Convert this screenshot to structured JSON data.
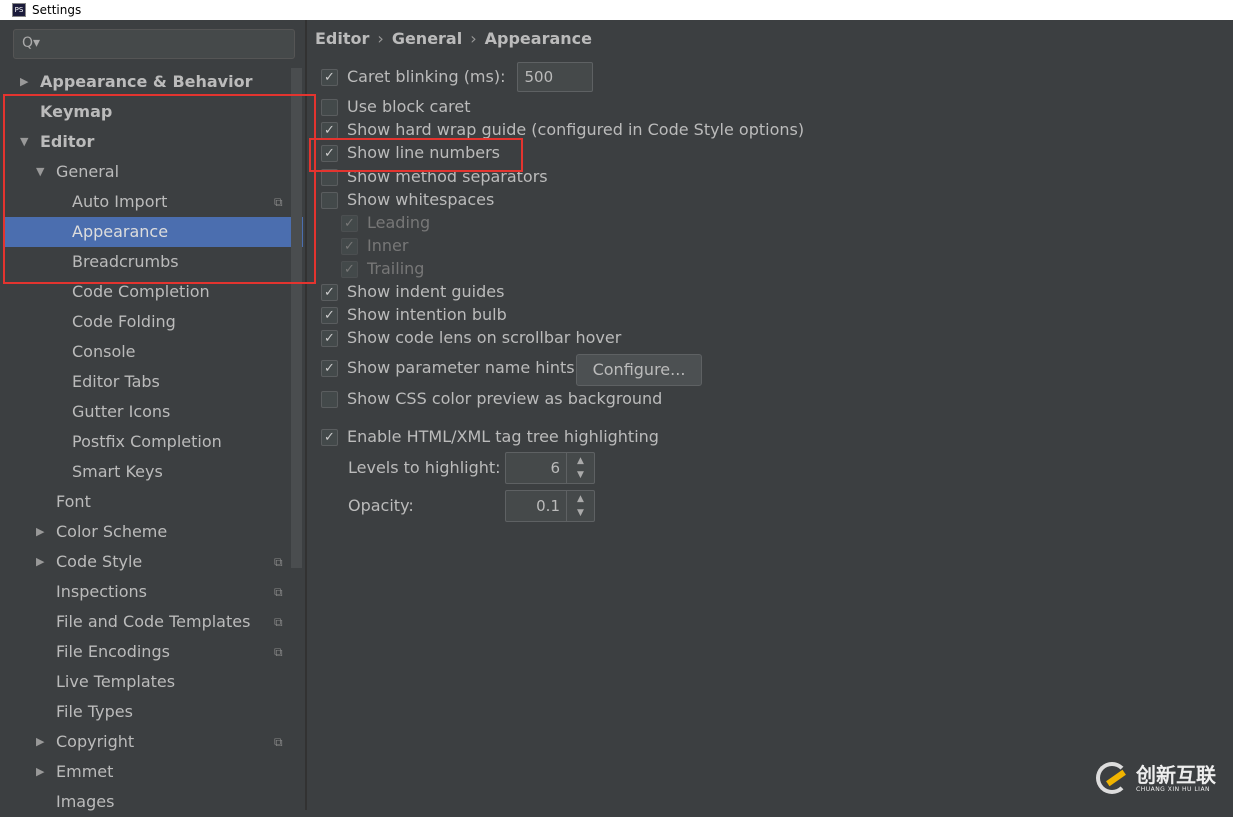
{
  "window": {
    "title": "Settings"
  },
  "search": {
    "placeholder": "Q▾"
  },
  "tree": [
    {
      "label": "Appearance & Behavior",
      "level": 0,
      "arrow": "right",
      "bold": true
    },
    {
      "label": "Keymap",
      "level": 0,
      "bold": true
    },
    {
      "label": "Editor",
      "level": 0,
      "arrow": "down",
      "bold": true
    },
    {
      "label": "General",
      "level": 1,
      "arrow": "down"
    },
    {
      "label": "Auto Import",
      "level": 2,
      "project": true
    },
    {
      "label": "Appearance",
      "level": 2,
      "selected": true
    },
    {
      "label": "Breadcrumbs",
      "level": 2
    },
    {
      "label": "Code Completion",
      "level": 2
    },
    {
      "label": "Code Folding",
      "level": 2
    },
    {
      "label": "Console",
      "level": 2
    },
    {
      "label": "Editor Tabs",
      "level": 2
    },
    {
      "label": "Gutter Icons",
      "level": 2
    },
    {
      "label": "Postfix Completion",
      "level": 2
    },
    {
      "label": "Smart Keys",
      "level": 2
    },
    {
      "label": "Font",
      "level": 1
    },
    {
      "label": "Color Scheme",
      "level": 1,
      "arrow": "right"
    },
    {
      "label": "Code Style",
      "level": 1,
      "arrow": "right",
      "project": true
    },
    {
      "label": "Inspections",
      "level": 1,
      "project": true
    },
    {
      "label": "File and Code Templates",
      "level": 1,
      "project": true
    },
    {
      "label": "File Encodings",
      "level": 1,
      "project": true
    },
    {
      "label": "Live Templates",
      "level": 1
    },
    {
      "label": "File Types",
      "level": 1
    },
    {
      "label": "Copyright",
      "level": 1,
      "arrow": "right",
      "project": true
    },
    {
      "label": "Emmet",
      "level": 1,
      "arrow": "right"
    },
    {
      "label": "Images",
      "level": 1
    }
  ],
  "breadcrumb": [
    "Editor",
    "General",
    "Appearance"
  ],
  "options": [
    {
      "label": "Caret blinking (ms):",
      "checked": true,
      "value": "500"
    },
    {
      "label": "Use block caret",
      "checked": false
    },
    {
      "label": "Show hard wrap guide (configured in Code Style options)",
      "checked": true
    },
    {
      "label": "Show line numbers",
      "checked": true
    },
    {
      "label": "Show method separators",
      "checked": false
    },
    {
      "label": "Show whitespaces",
      "checked": false
    },
    {
      "label": "Leading",
      "checked": true,
      "disabled": true,
      "indent": true
    },
    {
      "label": "Inner",
      "checked": true,
      "disabled": true,
      "indent": true
    },
    {
      "label": "Trailing",
      "checked": true,
      "disabled": true,
      "indent": true
    },
    {
      "label": "Show indent guides",
      "checked": true
    },
    {
      "label": "Show intention bulb",
      "checked": true
    },
    {
      "label": "Show code lens on scrollbar hover",
      "checked": true
    },
    {
      "label": "Show parameter name hints",
      "checked": true
    },
    {
      "label": "Show CSS color preview as background",
      "checked": false
    },
    {
      "label": "Enable HTML/XML tag tree highlighting",
      "checked": true
    }
  ],
  "configure_label": "Configure...",
  "levels": {
    "label": "Levels to highlight:",
    "value": "6"
  },
  "opacity": {
    "label": "Opacity:",
    "value": "0.1"
  },
  "watermark": {
    "cn": "创新互联",
    "en": "CHUANG XIN HU LIAN"
  },
  "colors": {
    "selection": "#4b6eaf",
    "highlight": "#e3342f",
    "background": "#3c3f41"
  }
}
